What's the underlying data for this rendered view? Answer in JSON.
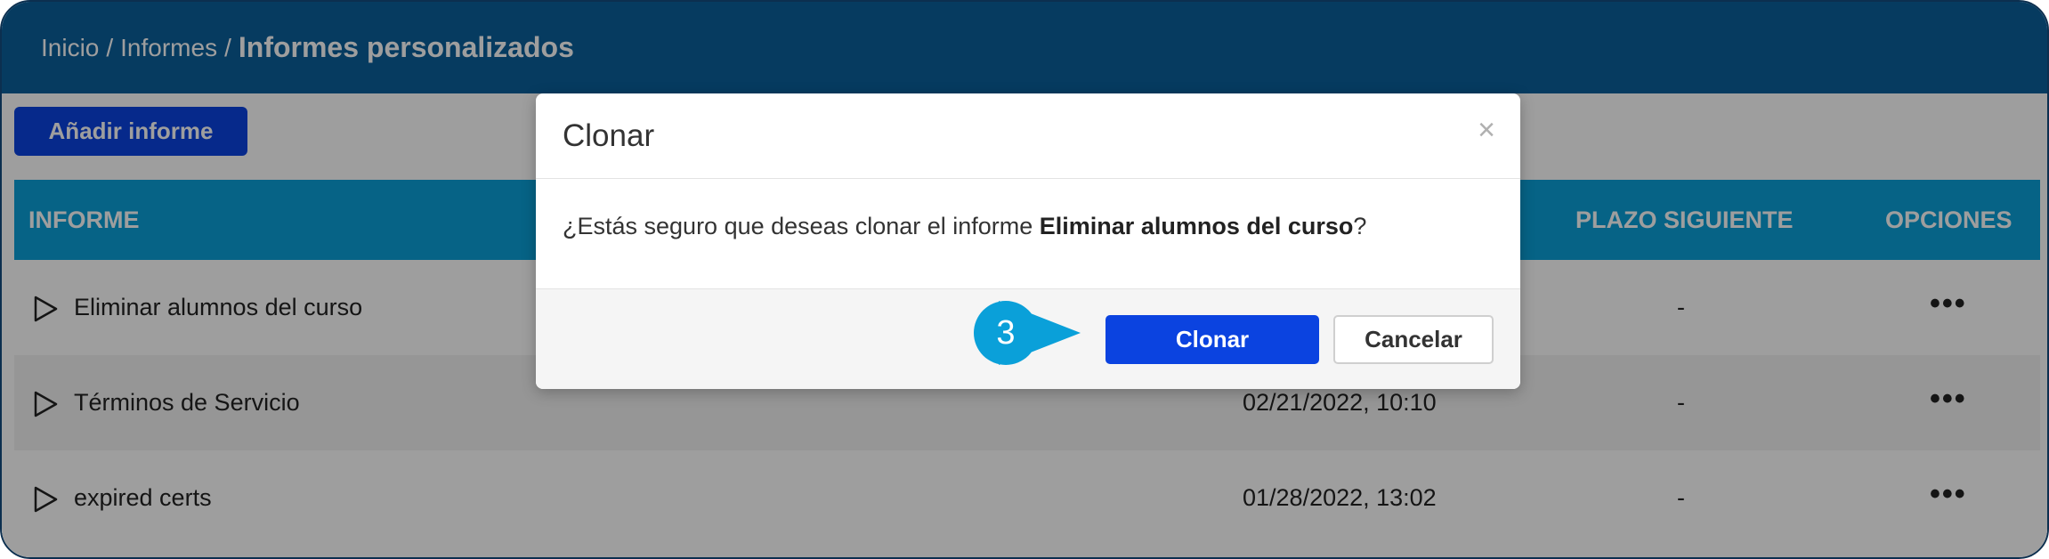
{
  "breadcrumb": {
    "home": "Inicio",
    "sep1": "/",
    "reports": "Informes",
    "sep2": "/",
    "current": "Informes personalizados"
  },
  "toolbar": {
    "add_label": "Añadir informe"
  },
  "table": {
    "headers": {
      "informe": "INFORME",
      "plazo": "PLAZO SIGUIENTE",
      "opciones": "OPCIONES"
    },
    "rows": [
      {
        "name": "Eliminar alumnos del curso",
        "date": "",
        "plazo": "-"
      },
      {
        "name": "Términos de Servicio",
        "date": "02/21/2022, 10:10",
        "plazo": "-"
      },
      {
        "name": "expired certs",
        "date": "01/28/2022, 13:02",
        "plazo": "-"
      }
    ],
    "options_icon": "more-horizontal-icon"
  },
  "modal": {
    "title": "Clonar",
    "close_label": "×",
    "message_prefix": "¿Estás seguro que deseas clonar el informe ",
    "message_bold": "Eliminar alumnos del curso",
    "message_suffix": "?",
    "confirm_label": "Clonar",
    "cancel_label": "Cancelar"
  },
  "callout": {
    "step": "3"
  },
  "colors": {
    "topbar": "#0b5f9c",
    "header": "#0aa0d9",
    "primary": "#0b43e0",
    "callout": "#0aa0d9"
  }
}
